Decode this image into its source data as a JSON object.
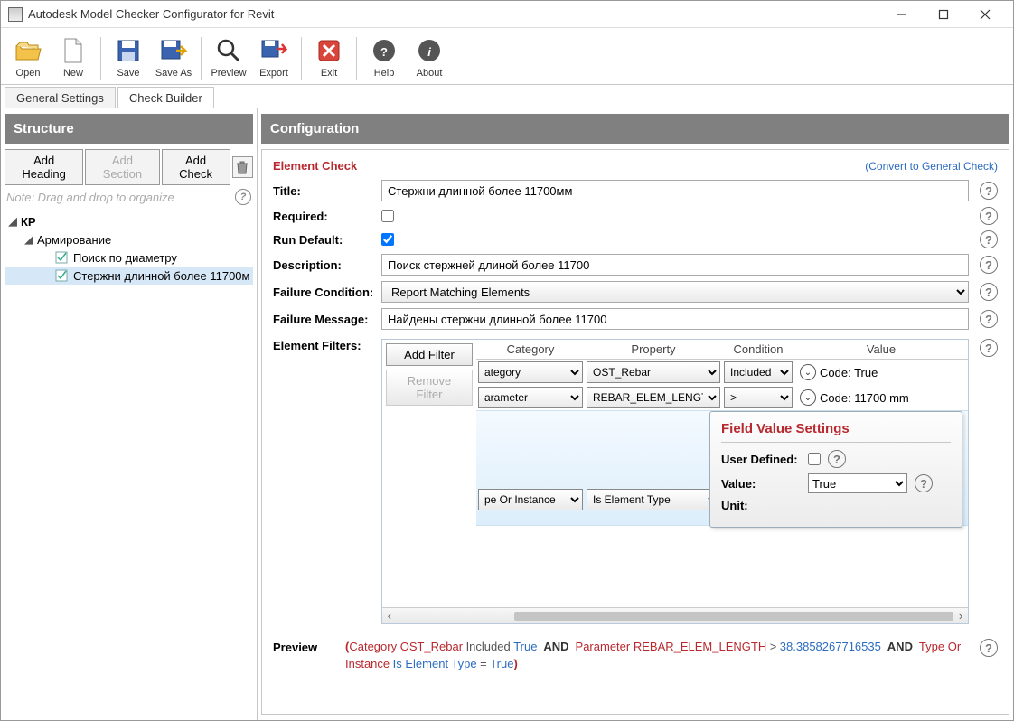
{
  "window": {
    "title": "Autodesk Model Checker Configurator for Revit"
  },
  "toolbar": {
    "open": "Open",
    "new": "New",
    "save": "Save",
    "saveas": "Save As",
    "preview": "Preview",
    "export": "Export",
    "exit": "Exit",
    "help": "Help",
    "about": "About"
  },
  "tabs": {
    "general": "General Settings",
    "builder": "Check Builder"
  },
  "structure": {
    "heading": "Structure",
    "add_heading": "Add Heading",
    "add_section": "Add Section",
    "add_check": "Add Check",
    "hint": "Note: Drag and drop to organize",
    "tree": {
      "root": "КР",
      "child": "Армирование",
      "leaf1": "Поиск по диаметру",
      "leaf2": "Стержни длинной более 11700м"
    }
  },
  "config": {
    "heading": "Configuration",
    "section": "Element Check",
    "convert": "(Convert to General Check)",
    "title_lbl": "Title:",
    "title_val": "Стержни длинной более 11700мм",
    "required_lbl": "Required:",
    "rundefault_lbl": "Run Default:",
    "desc_lbl": "Description:",
    "desc_val": "Поиск стержней длиной более 11700",
    "failcond_lbl": "Failure Condition:",
    "failcond_val": "Report Matching Elements",
    "failmsg_lbl": "Failure Message:",
    "failmsg_val": "Найдены стержни длинной более 11700",
    "filters_lbl": "Element Filters:",
    "add_filter": "Add Filter",
    "remove_filter": "Remove Filter",
    "cols": {
      "category": "Category",
      "property": "Property",
      "condition": "Condition",
      "value": "Value"
    },
    "rows": [
      {
        "cat": "ategory",
        "prop": "OST_Rebar",
        "cond": "Included",
        "code": "Code: True"
      },
      {
        "cat": "arameter",
        "prop": "REBAR_ELEM_LENGTH",
        "cond": ">",
        "code": "Code: 11700 mm"
      },
      {
        "code": "Code: True"
      },
      {
        "cat": "pe Or Instance",
        "prop": "Is Element Type",
        "cond": "="
      }
    ],
    "popup": {
      "title": "Field Value Settings",
      "userdef": "User Defined:",
      "value_lbl": "Value:",
      "value": "True",
      "unit_lbl": "Unit:"
    },
    "preview_lbl": "Preview",
    "preview": {
      "p1": "Category OST_Rebar",
      "inc": "Included",
      "true1": "True",
      "and": "AND",
      "p2": "Parameter REBAR_ELEM_LENGTH",
      "gt": ">",
      "num": "38.3858267716535",
      "p3": "Type Or Instance",
      "p4": "Is Element Type",
      "eq": "=",
      "true2": "True"
    }
  }
}
